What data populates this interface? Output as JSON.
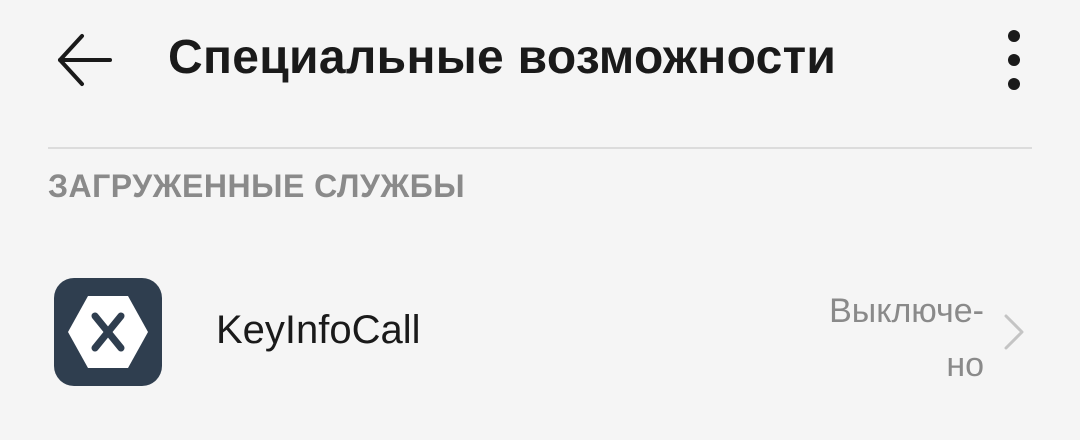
{
  "header": {
    "title": "Специальные возможности",
    "back_icon": "arrow-left-icon",
    "menu_icon": "more-vert-icon"
  },
  "section": {
    "title": "ЗАГРУЖЕННЫЕ СЛУЖБЫ"
  },
  "services": [
    {
      "name": "KeyInfoCall",
      "status_line1": "Выключе-",
      "status_line2": "но",
      "icon": "xamarin-app-icon",
      "icon_color": "#2f3e4f"
    }
  ],
  "colors": {
    "background": "#f5f5f5",
    "text_primary": "#1a1a1a",
    "text_secondary": "#8a8a8a",
    "divider": "#dcdcdc"
  }
}
